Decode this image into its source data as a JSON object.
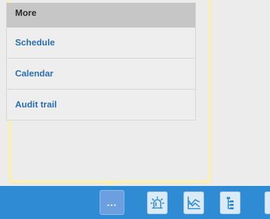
{
  "menu": {
    "header": "More",
    "items": [
      {
        "label": "Schedule"
      },
      {
        "label": "Calendar"
      },
      {
        "label": "Audit trail"
      }
    ]
  },
  "toolbar": {
    "more_label": "...",
    "buttons": [
      {
        "icon": "alarm-light-icon"
      },
      {
        "icon": "line-chart-icon"
      },
      {
        "icon": "tree-hierarchy-icon"
      }
    ]
  },
  "colors": {
    "toolbar_bg": "#2f8bd4",
    "link_text": "#2b6fb3",
    "popover_border": "#fbefb3",
    "header_bg": "#c6c6c6"
  }
}
